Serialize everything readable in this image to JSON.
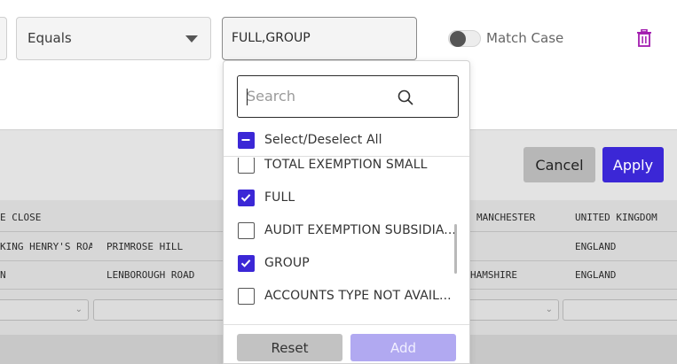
{
  "filter": {
    "operator": "Equals",
    "value": "FULL,GROUP",
    "match_case_label": "Match Case",
    "match_case_on": false
  },
  "actions": {
    "cancel_label": "Cancel",
    "apply_label": "Apply"
  },
  "dropdown": {
    "search_placeholder": "Search",
    "select_all_label": "Select/Deselect All",
    "select_all_state": "partial",
    "items": [
      {
        "label": "TOTAL EXEMPTION SMALL",
        "checked": false
      },
      {
        "label": "FULL",
        "checked": true
      },
      {
        "label": "AUDIT EXEMPTION SUBSIDIA...",
        "checked": false
      },
      {
        "label": "GROUP",
        "checked": true
      },
      {
        "label": "ACCOUNTS TYPE NOT AVAIL...",
        "checked": false
      }
    ],
    "reset_label": "Reset",
    "add_label": "Add"
  },
  "background_table": {
    "rows": [
      [
        "E CLOSE",
        "",
        "MANCHESTER",
        "UNITED KINGDOM"
      ],
      [
        "KING HENRY'S ROA",
        "PRIMROSE HILL",
        "",
        "ENGLAND"
      ],
      [
        "N",
        "LENBOROUGH ROAD",
        "HAMSHIRE",
        "ENGLAND"
      ]
    ]
  },
  "colors": {
    "accent": "#3b27d6",
    "accent_disabled": "#b1a9f1",
    "delete": "#a21caf"
  }
}
